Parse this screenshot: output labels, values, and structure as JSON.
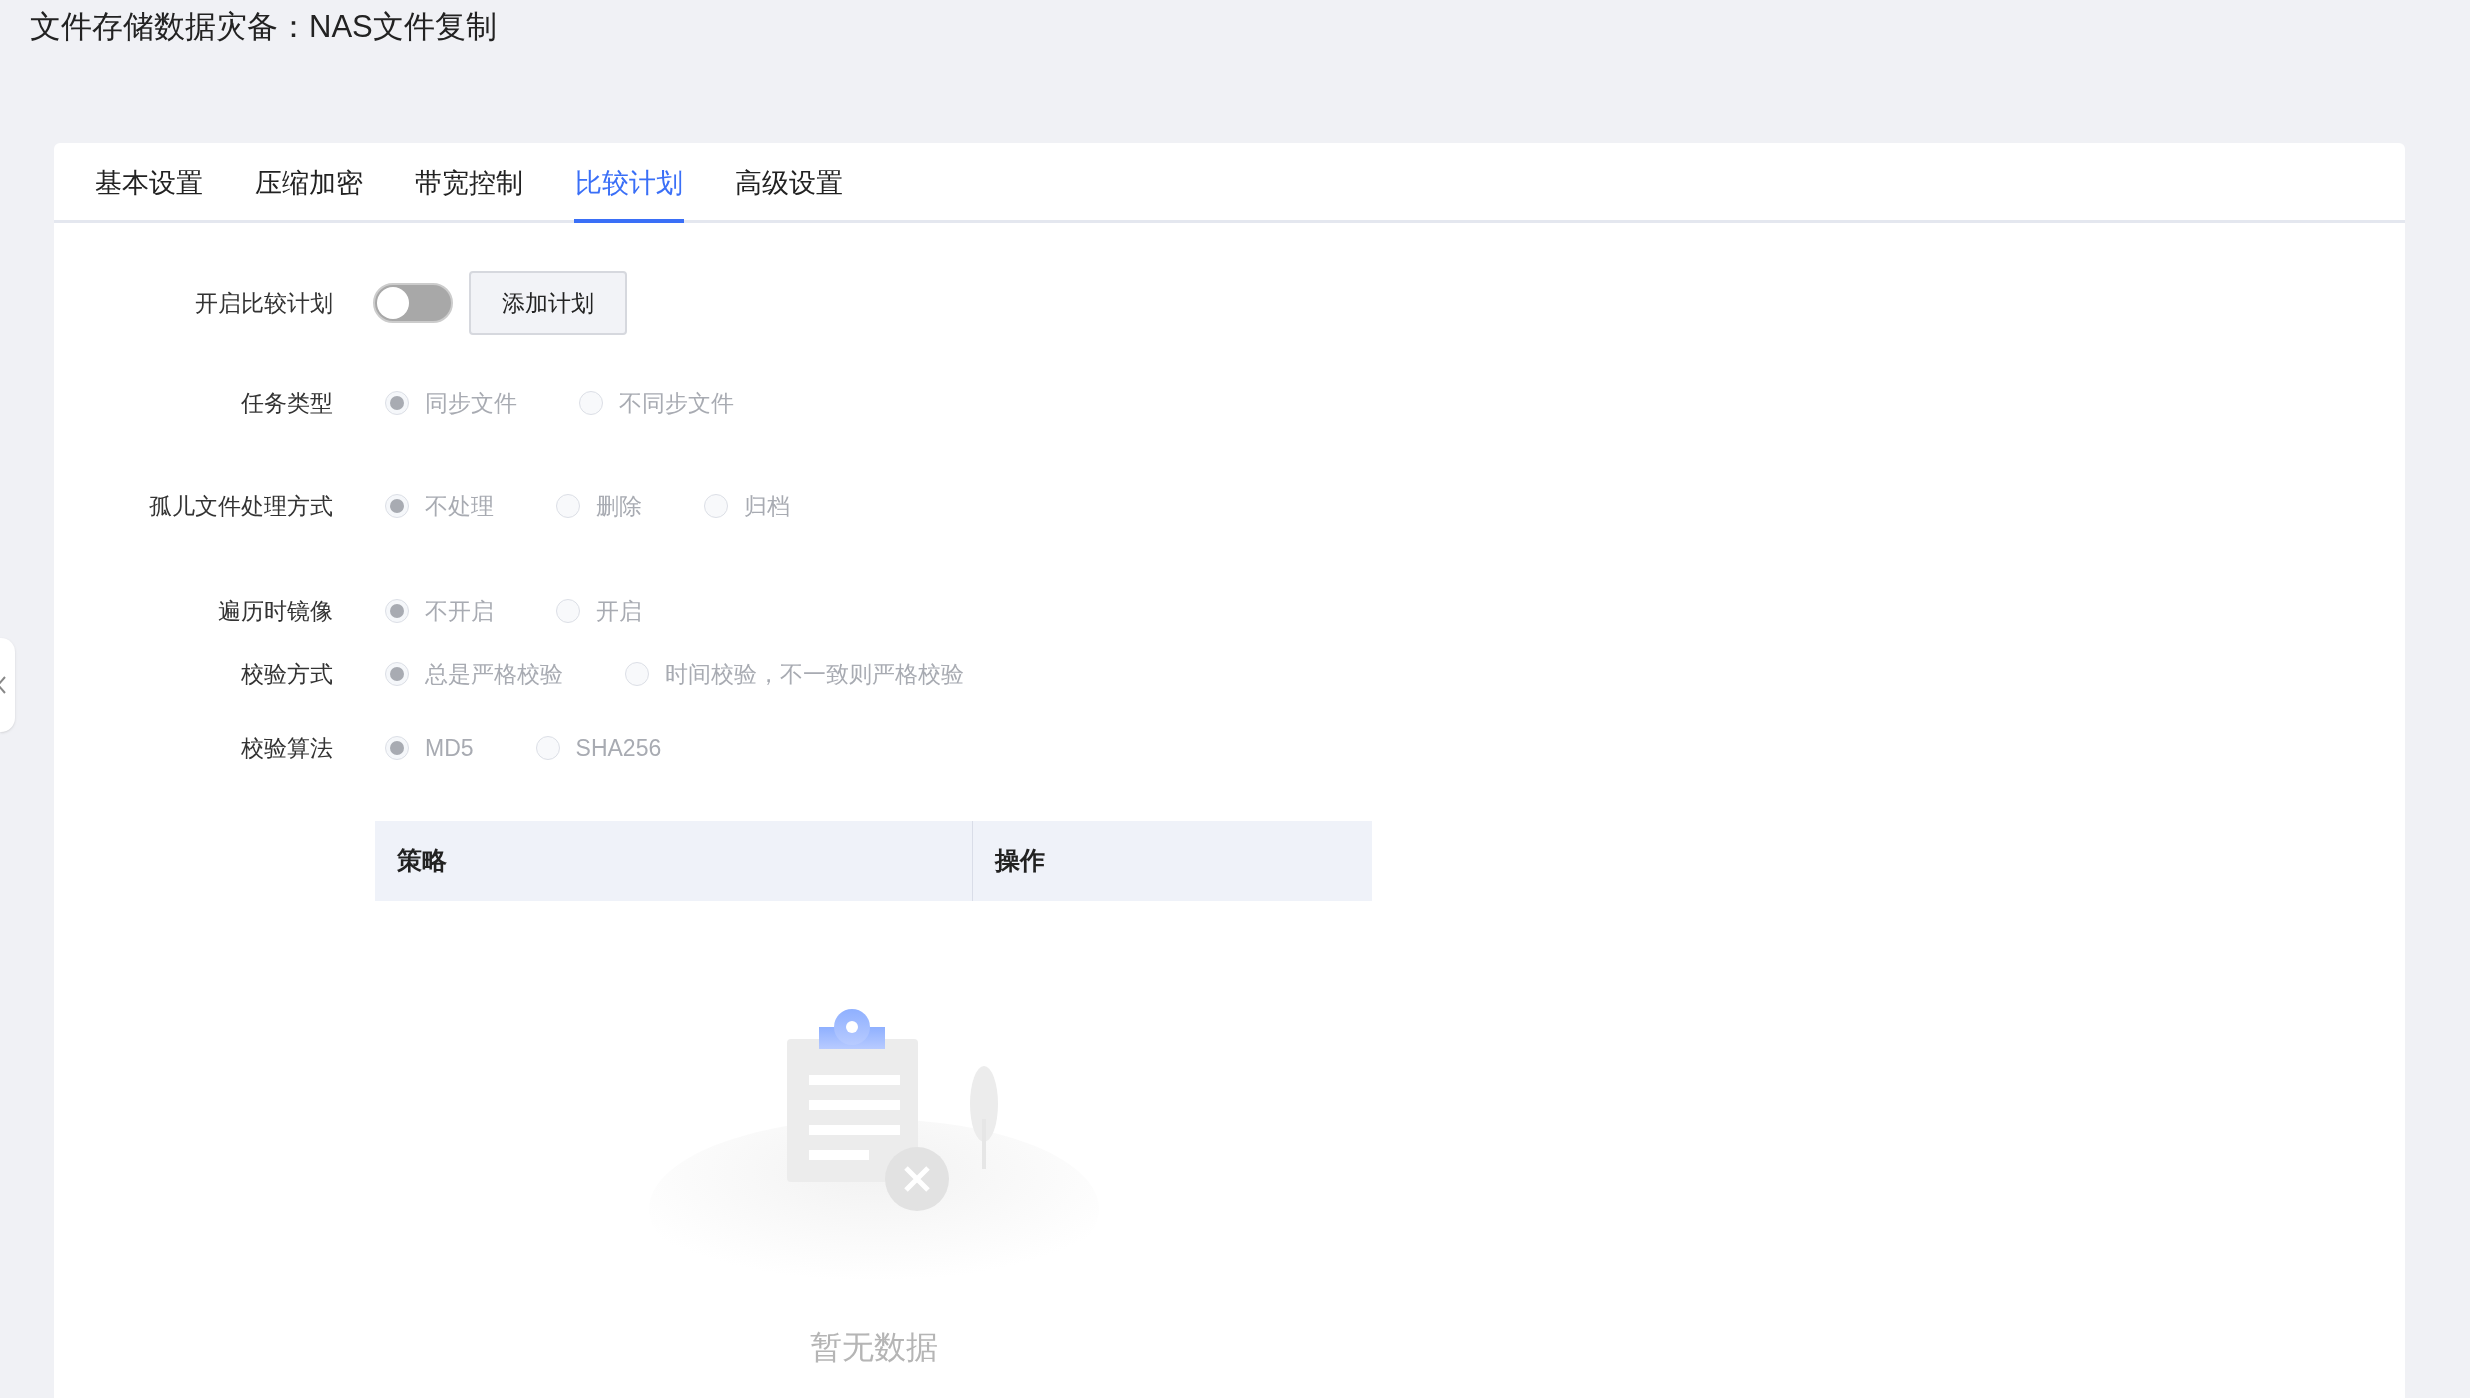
{
  "page_title": "文件存储数据灾备：NAS文件复制",
  "tabs": [
    {
      "label": "基本设置",
      "selected": false
    },
    {
      "label": "压缩加密",
      "selected": false
    },
    {
      "label": "带宽控制",
      "selected": false
    },
    {
      "label": "比较计划",
      "selected": true
    },
    {
      "label": "高级设置",
      "selected": false
    }
  ],
  "compare_plan": {
    "label": "开启比较计划",
    "on": false,
    "button": "添加计划"
  },
  "radio_groups": [
    {
      "label": "任务类型",
      "disabled": true,
      "options": [
        {
          "label": "同步文件",
          "selected": true
        },
        {
          "label": "不同步文件",
          "selected": false
        }
      ]
    },
    {
      "label": "孤儿文件处理方式",
      "disabled": true,
      "options": [
        {
          "label": "不处理",
          "selected": true
        },
        {
          "label": "删除",
          "selected": false
        },
        {
          "label": "归档",
          "selected": false
        }
      ]
    },
    {
      "label": "遍历时镜像",
      "disabled": true,
      "options": [
        {
          "label": "不开启",
          "selected": true
        },
        {
          "label": "开启",
          "selected": false
        }
      ]
    },
    {
      "label": "校验方式",
      "disabled": true,
      "options": [
        {
          "label": "总是严格校验",
          "selected": true
        },
        {
          "label": "时间校验，不一致则严格校验",
          "selected": false
        }
      ]
    },
    {
      "label": "校验算法",
      "disabled": true,
      "options": [
        {
          "label": "MD5",
          "selected": true
        },
        {
          "label": "SHA256",
          "selected": false
        }
      ]
    }
  ],
  "table": {
    "columns": [
      "策略",
      "操作"
    ],
    "empty_text": "暂无数据"
  }
}
